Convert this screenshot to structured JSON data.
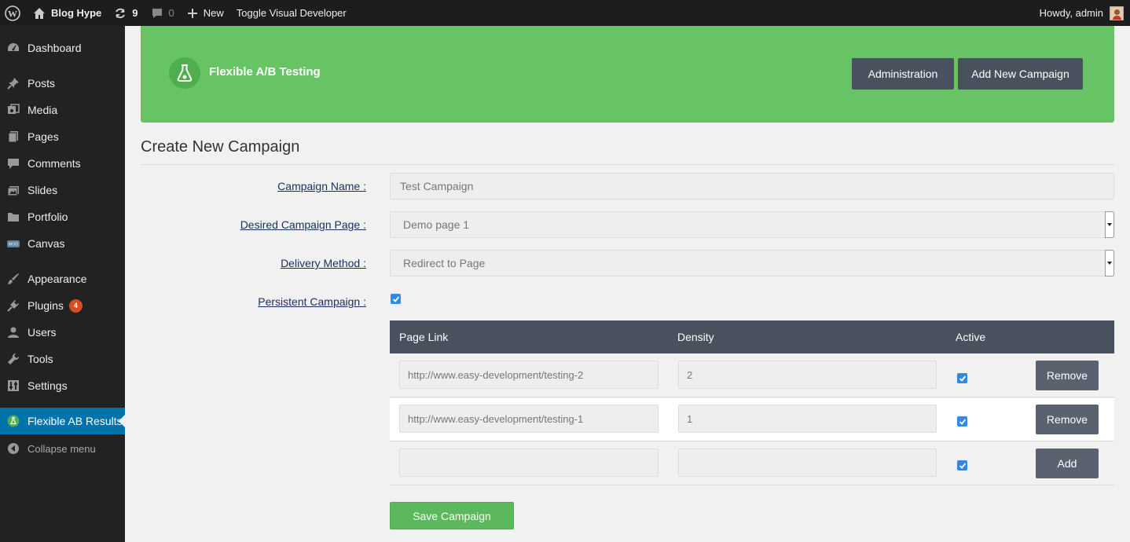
{
  "adminbar": {
    "site_name": "Blog Hype",
    "updates_count": "9",
    "comments_count": "0",
    "new_label": "New",
    "toggle_label": "Toggle Visual Developer",
    "howdy": "Howdy, admin"
  },
  "sidebar": {
    "items": [
      {
        "label": "Dashboard",
        "icon": "dashboard-icon"
      },
      {
        "label": "Posts",
        "icon": "pin-icon"
      },
      {
        "label": "Media",
        "icon": "media-icon"
      },
      {
        "label": "Pages",
        "icon": "pages-icon"
      },
      {
        "label": "Comments",
        "icon": "comment-icon"
      },
      {
        "label": "Slides",
        "icon": "slides-icon"
      },
      {
        "label": "Portfolio",
        "icon": "folder-icon"
      },
      {
        "label": "Canvas",
        "icon": "woo-icon"
      },
      {
        "label": "Appearance",
        "icon": "brush-icon"
      },
      {
        "label": "Plugins",
        "icon": "plug-icon",
        "badge": "4"
      },
      {
        "label": "Users",
        "icon": "user-icon"
      },
      {
        "label": "Tools",
        "icon": "wrench-icon"
      },
      {
        "label": "Settings",
        "icon": "settings-icon"
      },
      {
        "label": "Flexible AB Results",
        "icon": "flask-icon",
        "active": true
      }
    ],
    "collapse_label": "Collapse menu"
  },
  "banner": {
    "brand": "Flexible A/B Testing",
    "administration_label": "Administration",
    "add_campaign_label": "Add New Campaign",
    "color": "#66c464"
  },
  "page_title": "Create New Campaign",
  "form": {
    "campaign_name_label": "Campaign Name :",
    "campaign_name_value": "Test Campaign",
    "page_label": "Desired Campaign Page :",
    "page_value": "Demo page 1",
    "delivery_label": "Delivery Method :",
    "delivery_value": "Redirect to Page",
    "persistent_label": "Persistent Campaign :",
    "persistent_checked": true
  },
  "table": {
    "headers": [
      "Page Link",
      "Density",
      "Active"
    ],
    "rows": [
      {
        "link": "http://www.easy-development/testing-2",
        "density": "2",
        "active": true,
        "action": "Remove"
      },
      {
        "link": "http://www.easy-development/testing-1",
        "density": "1",
        "active": true,
        "action": "Remove"
      },
      {
        "link": "",
        "density": "",
        "active": true,
        "action": "Add"
      }
    ]
  },
  "save_label": "Save Campaign"
}
